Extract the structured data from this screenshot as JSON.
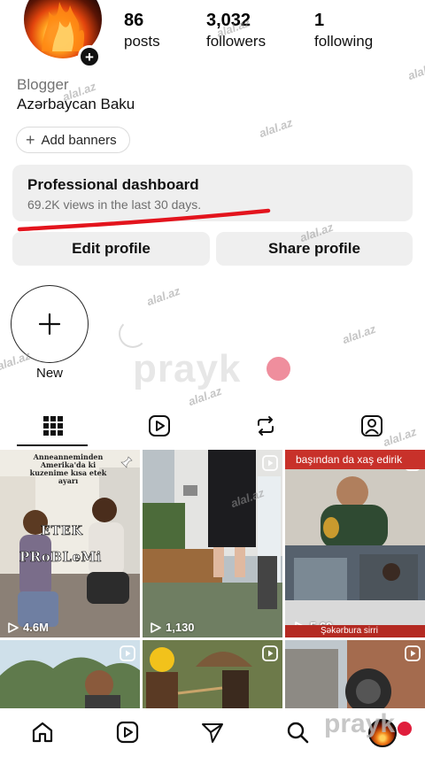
{
  "profile": {
    "category": "Blogger",
    "location": "Azərbaycan Baku",
    "add_banners_label": "Add banners"
  },
  "stats": [
    {
      "value": "86",
      "label": "posts"
    },
    {
      "value": "3,032",
      "label": "followers"
    },
    {
      "value": "1",
      "label": "following"
    }
  ],
  "dashboard": {
    "title": "Professional dashboard",
    "subtitle": "69.2K views in the last 30 days."
  },
  "buttons": {
    "edit_profile": "Edit profile",
    "share_profile": "Share profile"
  },
  "highlights": {
    "new_label": "New"
  },
  "tabs": [
    "grid-icon",
    "reels-icon",
    "reposts-icon",
    "tagged-icon"
  ],
  "grid": {
    "post1": {
      "caption": "Anneanneminden Amerika'da ki kuzenime kısa etek ayarı",
      "overlay1": "ETEK",
      "overlay2": "PRoBLeMi",
      "views": "4.6M"
    },
    "post2": {
      "views": "1,130"
    },
    "post3": {
      "top_text": "başından da xaş edirik",
      "views": "5.69",
      "bottom_text": "Şəkərbura sirri"
    }
  },
  "watermarks": {
    "site": "alal.az",
    "brand": "prayk"
  },
  "colors": {
    "accent_red": "#e01e3c",
    "button_gray": "#efefef",
    "news_red": "#c8312a"
  }
}
